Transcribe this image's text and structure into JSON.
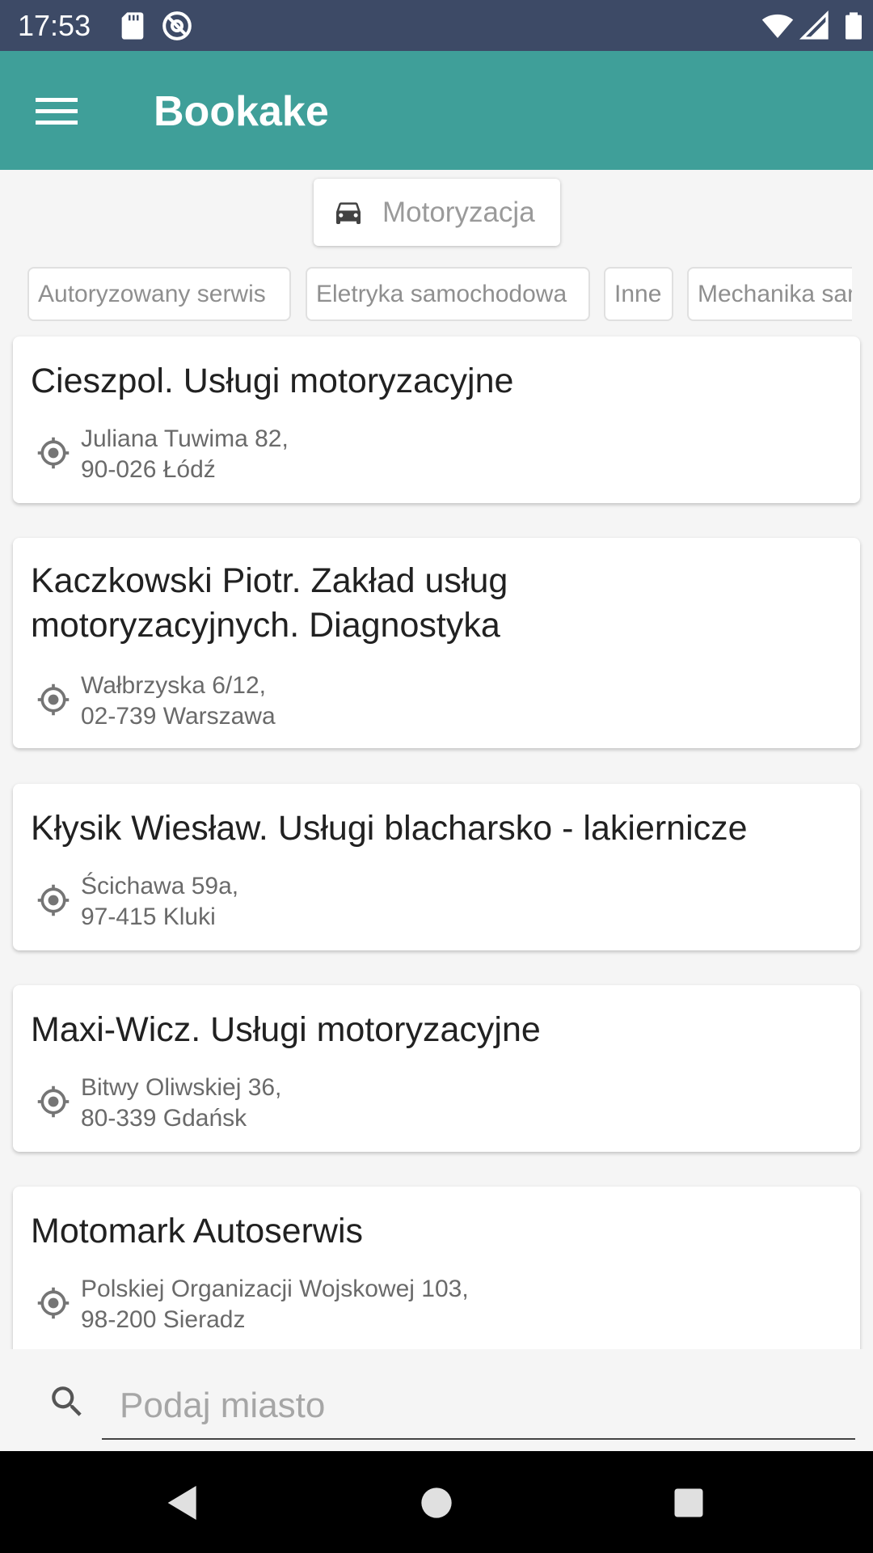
{
  "status_bar": {
    "time": "17:53"
  },
  "app_bar": {
    "title": "Bookake"
  },
  "category": {
    "label": "Motoryzacja"
  },
  "filters": [
    "Autoryzowany serwis",
    "Eletryka samochodowa",
    "Inne",
    "Mechanika samochodowa"
  ],
  "listings": [
    {
      "name": "Cieszpol. Usługi motoryzacyjne",
      "address_line1": "Juliana Tuwima 82,",
      "address_line2": "90-026 Łódź"
    },
    {
      "name_line1": "Kaczkowski Piotr. Zakład usług",
      "name_line2": "motoryzacyjnych. Diagnostyka",
      "address_line1": "Wałbrzyska 6/12,",
      "address_line2": "02-739 Warszawa"
    },
    {
      "name": "Kłysik Wiesław. Usługi blacharsko - lakiernicze",
      "address_line1": "Ścichawa 59a,",
      "address_line2": "97-415 Kluki"
    },
    {
      "name": "Maxi-Wicz. Usługi motoryzacyjne",
      "address_line1": "Bitwy Oliwskiej 36,",
      "address_line2": "80-339 Gdańsk"
    },
    {
      "name": "Motomark Autoserwis",
      "address_line1": "Polskiej Organizacji Wojskowej 103,",
      "address_line2": "98-200 Sieradz"
    }
  ],
  "search": {
    "placeholder": "Podaj miasto",
    "value": ""
  },
  "colors": {
    "status_bar": "#3d4a66",
    "app_bar": "#3f9f99",
    "background": "#f5f5f5",
    "nav_bar": "#000000"
  },
  "icons": [
    "sd-card-icon",
    "at-sign-icon",
    "wifi-icon",
    "signal-icon",
    "battery-icon",
    "menu-icon",
    "car-icon",
    "location-icon",
    "search-icon",
    "back-icon",
    "home-icon",
    "recents-icon"
  ]
}
